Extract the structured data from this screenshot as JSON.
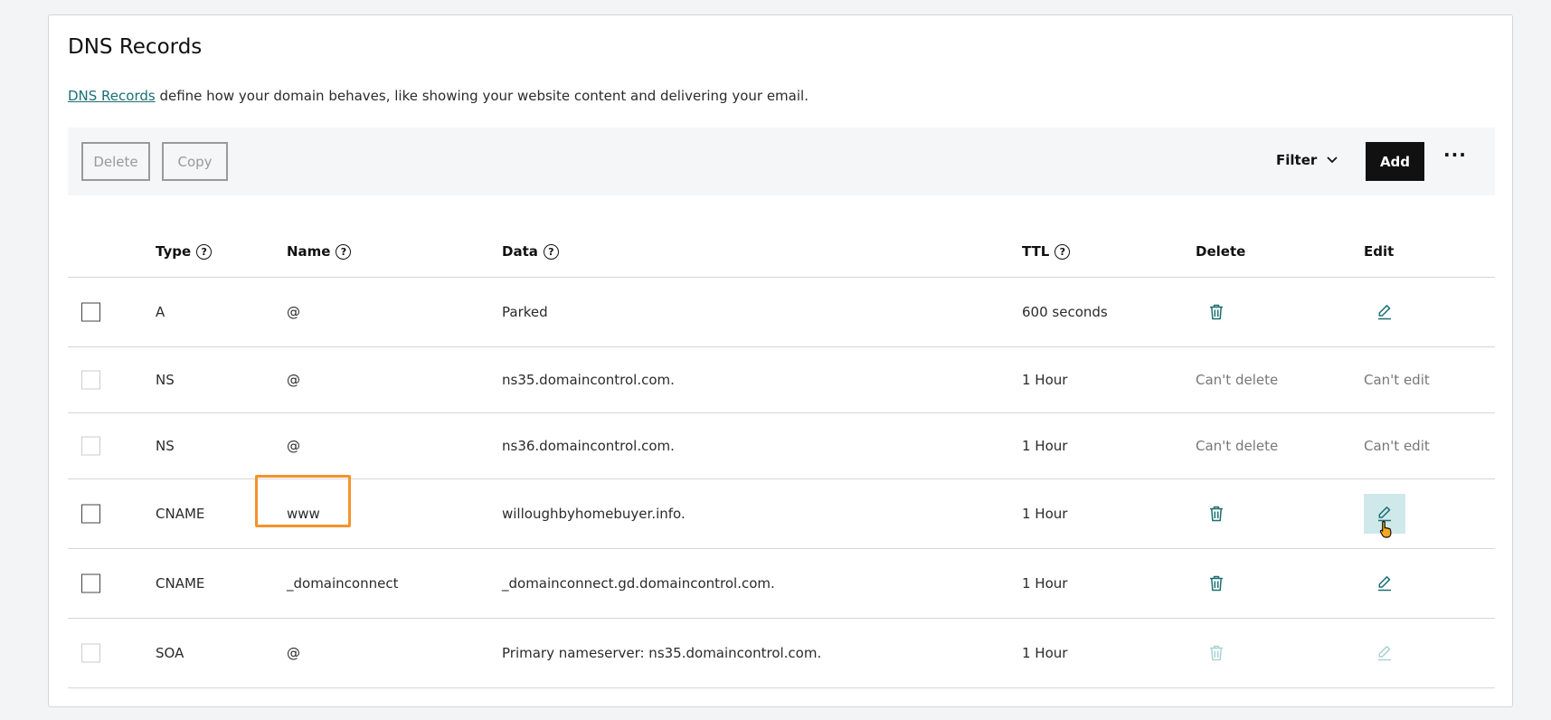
{
  "header": {
    "title": "DNS Records",
    "desc_link": "DNS Records",
    "desc_text": " define how your domain behaves, like showing your website content and delivering your email."
  },
  "toolbar": {
    "delete_label": "Delete",
    "copy_label": "Copy",
    "filter_label": "Filter",
    "add_label": "Add",
    "more_label": "···"
  },
  "columns": {
    "type": "Type",
    "name": "Name",
    "data": "Data",
    "ttl": "TTL",
    "delete": "Delete",
    "edit": "Edit"
  },
  "rows": [
    {
      "type": "A",
      "name": "@",
      "data": "Parked",
      "ttl": "600 seconds",
      "can_delete": true,
      "can_edit": true,
      "delete_text": "",
      "edit_text": ""
    },
    {
      "type": "NS",
      "name": "@",
      "data": "ns35.domaincontrol.com.",
      "ttl": "1 Hour",
      "can_delete": false,
      "can_edit": false,
      "delete_text": "Can't delete",
      "edit_text": "Can't edit"
    },
    {
      "type": "NS",
      "name": "@",
      "data": "ns36.domaincontrol.com.",
      "ttl": "1 Hour",
      "can_delete": false,
      "can_edit": false,
      "delete_text": "Can't delete",
      "edit_text": "Can't edit"
    },
    {
      "type": "CNAME",
      "name": "www",
      "data": "willoughbyhomebuyer.info.",
      "ttl": "1 Hour",
      "can_delete": true,
      "can_edit": true,
      "delete_text": "",
      "edit_text": ""
    },
    {
      "type": "CNAME",
      "name": "_domainconnect",
      "data": "_domainconnect.gd.domaincontrol.com.",
      "ttl": "1 Hour",
      "can_delete": true,
      "can_edit": true,
      "delete_text": "",
      "edit_text": ""
    },
    {
      "type": "SOA",
      "name": "@",
      "data": "Primary nameserver: ns35.domaincontrol.com.",
      "ttl": "1 Hour",
      "can_delete": false,
      "can_edit": false,
      "delete_text": "",
      "edit_text": ""
    }
  ],
  "colors": {
    "accent": "#1b6f74",
    "accent_disabled": "#a9d3d5",
    "highlight": "#f4932a",
    "hover": "#cfe9ea"
  },
  "icons": {
    "delete": "trash-icon",
    "edit": "pencil-icon",
    "help": "help-icon",
    "filter": "chevron-down-icon",
    "cursor": "hand-cursor-icon"
  }
}
